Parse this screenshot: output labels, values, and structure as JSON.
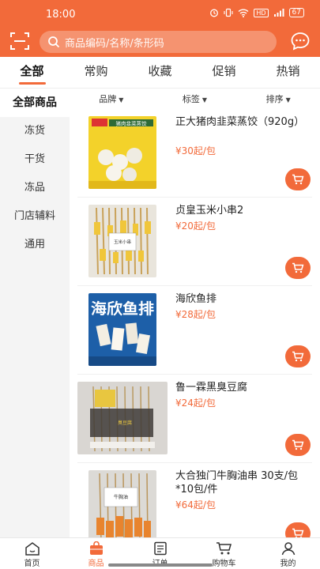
{
  "status": {
    "time": "18:00",
    "network": "HD",
    "battery": "67"
  },
  "search": {
    "placeholder": "商品编码/名称/条形码"
  },
  "tabs": [
    {
      "label": "全部",
      "active": true
    },
    {
      "label": "常购"
    },
    {
      "label": "收藏"
    },
    {
      "label": "促销"
    },
    {
      "label": "热销"
    }
  ],
  "sidebar": {
    "items": [
      {
        "label": "全部商品",
        "active": true
      },
      {
        "label": "冻货"
      },
      {
        "label": "干货"
      },
      {
        "label": "冻品"
      },
      {
        "label": "门店辅料"
      },
      {
        "label": "通用"
      }
    ]
  },
  "filters": {
    "brand": "品牌",
    "tag": "标签",
    "sort": "排序"
  },
  "products": [
    {
      "name": "正大猪肉韭菜蒸饺（920g）",
      "price": "¥30起/包",
      "image_text": "猪肉韭菜蒸饺"
    },
    {
      "name": "贞皇玉米小串2",
      "price": "¥20起/包",
      "image_text": "玉米小串"
    },
    {
      "name": "海欣鱼排",
      "price": "¥28起/包",
      "image_text": "海欣鱼排"
    },
    {
      "name": "鲁一霖黑臭豆腐",
      "price": "¥24起/包",
      "image_text": "臭豆腐"
    },
    {
      "name": "大合独门牛胸油串 30支/包*10包/件",
      "price": "¥64起/包",
      "image_text": "牛胸油"
    }
  ],
  "bottom_nav": [
    {
      "label": "首页",
      "icon": "home-icon"
    },
    {
      "label": "商品",
      "icon": "bag-icon",
      "active": true
    },
    {
      "label": "订单",
      "icon": "order-icon"
    },
    {
      "label": "购物车",
      "icon": "cart-icon"
    },
    {
      "label": "我的",
      "icon": "user-icon"
    }
  ],
  "colors": {
    "accent": "#f26a3a"
  }
}
